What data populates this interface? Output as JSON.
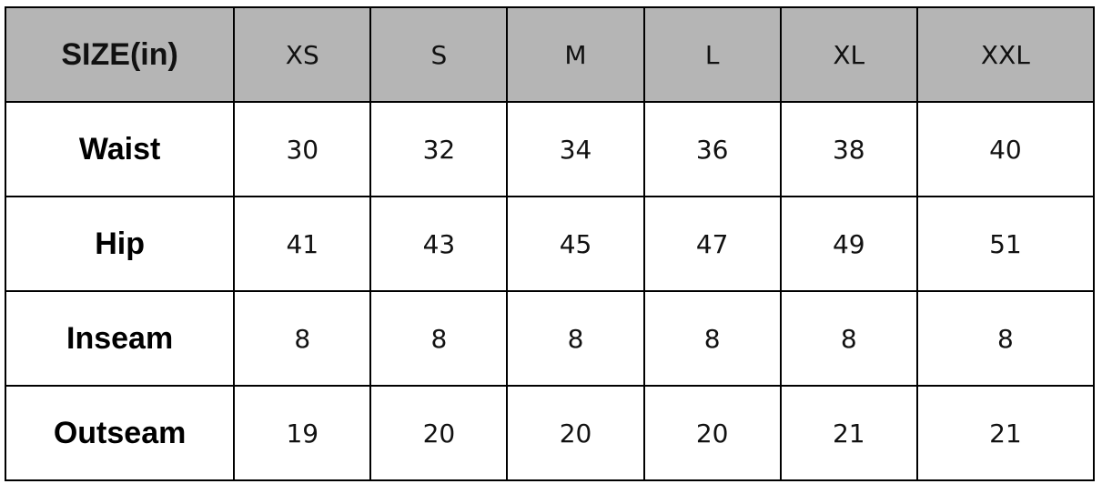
{
  "table": {
    "corner_label": "SIZE(in)",
    "columns": [
      "XS",
      "S",
      "M",
      "L",
      "XL",
      "XXL"
    ],
    "rows": [
      {
        "label": "Waist",
        "values": [
          "30",
          "32",
          "34",
          "36",
          "38",
          "40"
        ]
      },
      {
        "label": "Hip",
        "values": [
          "41",
          "43",
          "45",
          "47",
          "49",
          "51"
        ]
      },
      {
        "label": "Inseam",
        "values": [
          "8",
          "8",
          "8",
          "8",
          "8",
          "8"
        ]
      },
      {
        "label": "Outseam",
        "values": [
          "19",
          "20",
          "20",
          "20",
          "21",
          "21"
        ]
      }
    ],
    "header_bg": "#b5b5b5"
  }
}
